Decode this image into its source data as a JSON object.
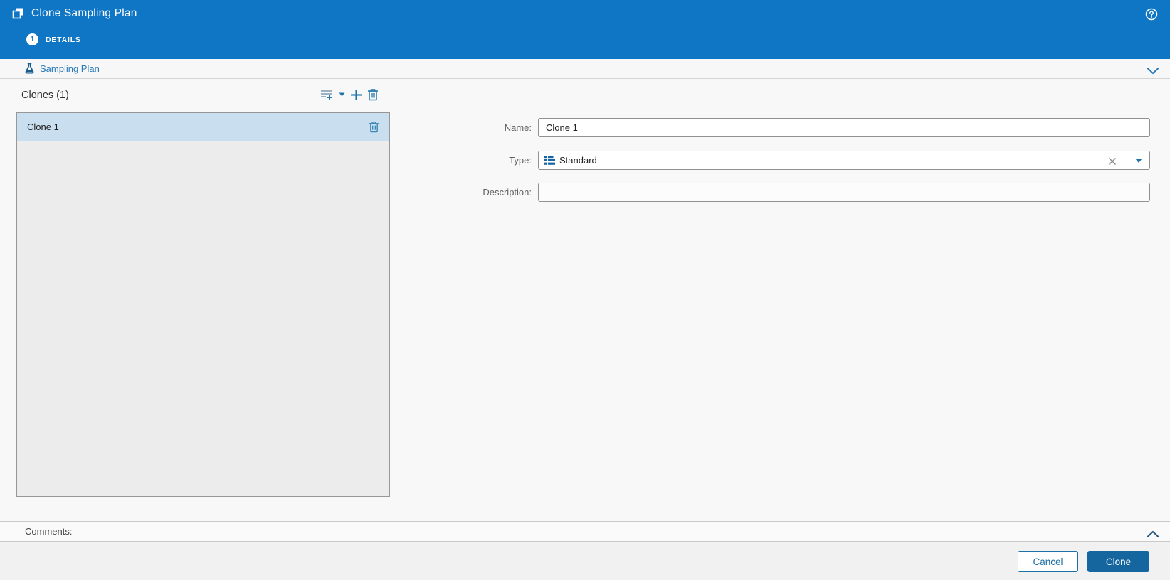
{
  "header": {
    "title": "Clone Sampling Plan",
    "step_number": "1",
    "step_label": "DETAILS"
  },
  "section_bar": {
    "title": "Sampling Plan"
  },
  "clones_panel": {
    "heading": "Clones (1)",
    "items": [
      {
        "name": "Clone 1",
        "selected": true
      }
    ]
  },
  "form": {
    "name_label": "Name:",
    "name_value": "Clone 1",
    "type_label": "Type:",
    "type_value": "Standard",
    "description_label": "Description:",
    "description_value": ""
  },
  "comments_label": "Comments:",
  "footer": {
    "cancel_label": "Cancel",
    "clone_label": "Clone"
  },
  "colors": {
    "header_blue": "#0e76c4",
    "accent_blue": "#1c74ad",
    "link_blue": "#2a7ab9",
    "selected_row_blue": "#c9dff0",
    "primary_button_blue": "#15669f",
    "panel_gray": "#ececec"
  }
}
